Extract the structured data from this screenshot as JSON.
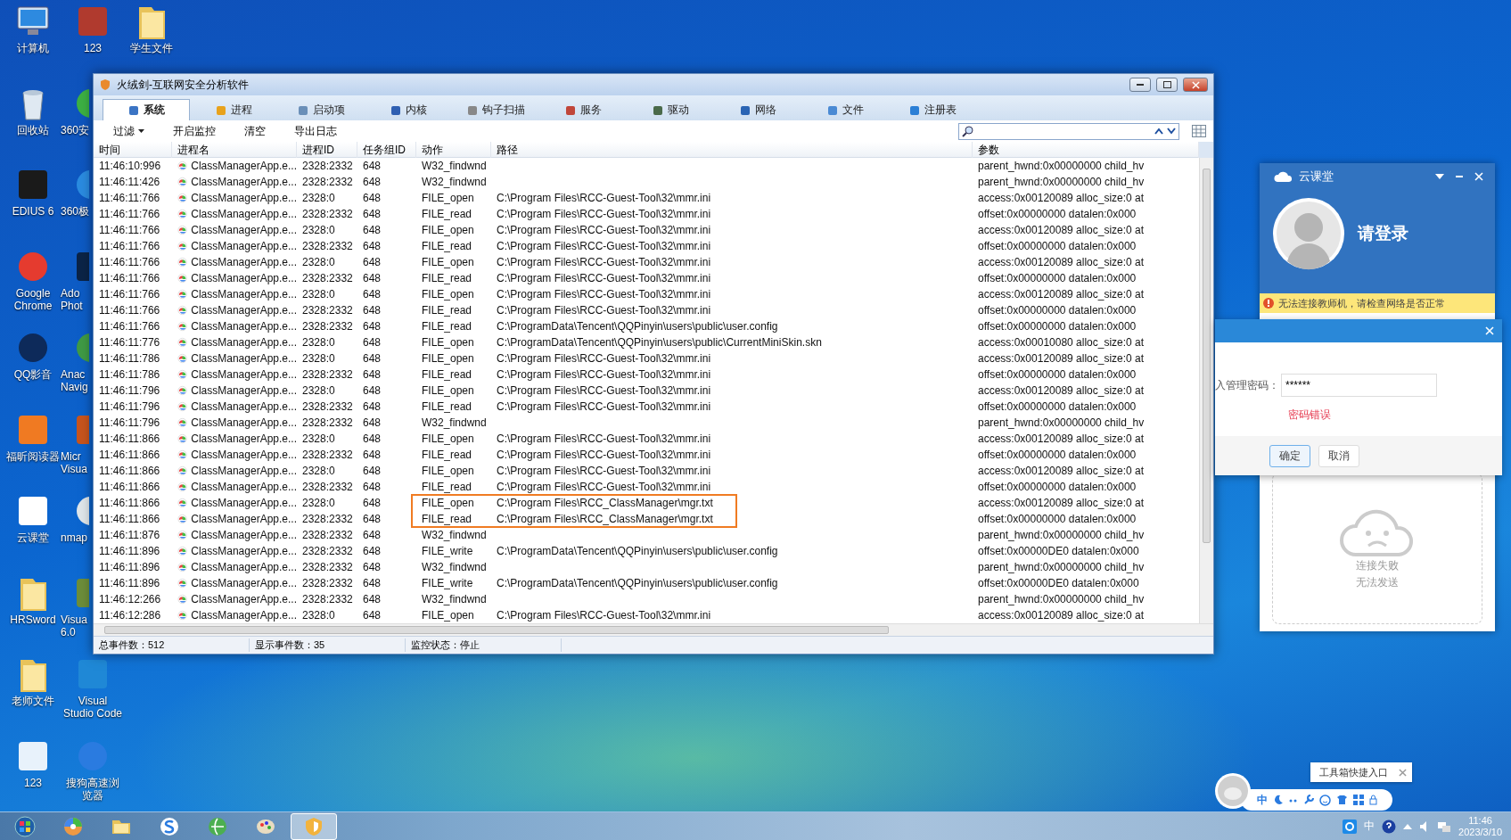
{
  "desktop": {
    "columns": [
      [
        {
          "label": "计算机",
          "kind": "computer"
        },
        {
          "label": "回收站",
          "kind": "bin"
        },
        {
          "label": "EDIUS 6",
          "kind": "tile",
          "color": "#1a1a1a"
        },
        {
          "label": "Google Chrome",
          "kind": "round",
          "color": "#e53b2f"
        },
        {
          "label": "QQ影音",
          "kind": "round",
          "color": "#0d2a5a"
        },
        {
          "label": "福昕阅读器",
          "kind": "tile",
          "color": "#f07a22"
        },
        {
          "label": "云课堂",
          "kind": "tile",
          "color": "#ffffff"
        },
        {
          "label": "HRSword",
          "kind": "folder"
        },
        {
          "label": "老师文件",
          "kind": "folder"
        },
        {
          "label": "123",
          "kind": "tile",
          "color": "#e8f2fb"
        }
      ],
      [
        {
          "label": "123",
          "kind": "tile",
          "color": "#b03a2e"
        },
        {
          "label": "360安",
          "kind": "round",
          "color": "#3cb043"
        },
        {
          "label": "360极",
          "kind": "round",
          "color": "#2a8be0"
        },
        {
          "label": "Ado Phot",
          "kind": "tile",
          "color": "#0b2447"
        },
        {
          "label": "Anac Navig",
          "kind": "round",
          "color": "#3f9a45"
        },
        {
          "label": "Micr Visua",
          "kind": "tile",
          "color": "#c7541d"
        },
        {
          "label": "nmap",
          "kind": "round",
          "color": "#dfe6ea"
        },
        {
          "label": "Visua 6.0",
          "kind": "tile",
          "color": "#6c8d3a"
        },
        {
          "label": "Visual Studio Code",
          "kind": "tile",
          "color": "#1f88d6"
        },
        {
          "label": "搜狗高速浏览器",
          "kind": "round",
          "color": "#2a7be0"
        }
      ],
      [
        {
          "label": "学生文件",
          "kind": "folder"
        }
      ]
    ]
  },
  "main_window": {
    "title": "火绒剑-互联网安全分析软件",
    "tabs": [
      {
        "label": "系统",
        "selected": true
      },
      {
        "label": "进程",
        "selected": false
      },
      {
        "label": "启动项",
        "selected": false
      },
      {
        "label": "内核",
        "selected": false
      },
      {
        "label": "钩子扫描",
        "selected": false
      },
      {
        "label": "服务",
        "selected": false
      },
      {
        "label": "驱动",
        "selected": false
      },
      {
        "label": "网络",
        "selected": false
      },
      {
        "label": "文件",
        "selected": false
      },
      {
        "label": "注册表",
        "selected": false
      }
    ],
    "toolbar": [
      "过滤",
      "开启监控",
      "清空",
      "导出日志"
    ],
    "columns": [
      "时间",
      "进程名",
      "进程ID",
      "任务组ID",
      "动作",
      "路径",
      "参数"
    ],
    "rows": [
      {
        "time": "11:46:10:996",
        "process": "ClassManagerApp.e...",
        "pid": "2328:2332",
        "task_group": "648",
        "action": "W32_findwnd",
        "path": "",
        "params": "parent_hwnd:0x00000000 child_hv",
        "highlighted": false
      },
      {
        "time": "11:46:11:426",
        "process": "ClassManagerApp.e...",
        "pid": "2328:2332",
        "task_group": "648",
        "action": "W32_findwnd",
        "path": "",
        "params": "parent_hwnd:0x00000000 child_hv",
        "highlighted": false
      },
      {
        "time": "11:46:11:766",
        "process": "ClassManagerApp.e...",
        "pid": "2328:0",
        "task_group": "648",
        "action": "FILE_open",
        "path": "C:\\Program Files\\RCC-Guest-Tool\\32\\mmr.ini",
        "params": "access:0x00120089 alloc_size:0 at",
        "highlighted": false
      },
      {
        "time": "11:46:11:766",
        "process": "ClassManagerApp.e...",
        "pid": "2328:2332",
        "task_group": "648",
        "action": "FILE_read",
        "path": "C:\\Program Files\\RCC-Guest-Tool\\32\\mmr.ini",
        "params": "offset:0x00000000 datalen:0x000",
        "highlighted": false
      },
      {
        "time": "11:46:11:766",
        "process": "ClassManagerApp.e...",
        "pid": "2328:0",
        "task_group": "648",
        "action": "FILE_open",
        "path": "C:\\Program Files\\RCC-Guest-Tool\\32\\mmr.ini",
        "params": "access:0x00120089 alloc_size:0 at",
        "highlighted": false
      },
      {
        "time": "11:46:11:766",
        "process": "ClassManagerApp.e...",
        "pid": "2328:2332",
        "task_group": "648",
        "action": "FILE_read",
        "path": "C:\\Program Files\\RCC-Guest-Tool\\32\\mmr.ini",
        "params": "offset:0x00000000 datalen:0x000",
        "highlighted": false
      },
      {
        "time": "11:46:11:766",
        "process": "ClassManagerApp.e...",
        "pid": "2328:0",
        "task_group": "648",
        "action": "FILE_open",
        "path": "C:\\Program Files\\RCC-Guest-Tool\\32\\mmr.ini",
        "params": "access:0x00120089 alloc_size:0 at",
        "highlighted": false
      },
      {
        "time": "11:46:11:766",
        "process": "ClassManagerApp.e...",
        "pid": "2328:2332",
        "task_group": "648",
        "action": "FILE_read",
        "path": "C:\\Program Files\\RCC-Guest-Tool\\32\\mmr.ini",
        "params": "offset:0x00000000 datalen:0x000",
        "highlighted": false
      },
      {
        "time": "11:46:11:766",
        "process": "ClassManagerApp.e...",
        "pid": "2328:0",
        "task_group": "648",
        "action": "FILE_open",
        "path": "C:\\Program Files\\RCC-Guest-Tool\\32\\mmr.ini",
        "params": "access:0x00120089 alloc_size:0 at",
        "highlighted": false
      },
      {
        "time": "11:46:11:766",
        "process": "ClassManagerApp.e...",
        "pid": "2328:2332",
        "task_group": "648",
        "action": "FILE_read",
        "path": "C:\\Program Files\\RCC-Guest-Tool\\32\\mmr.ini",
        "params": "offset:0x00000000 datalen:0x000",
        "highlighted": false
      },
      {
        "time": "11:46:11:766",
        "process": "ClassManagerApp.e...",
        "pid": "2328:2332",
        "task_group": "648",
        "action": "FILE_read",
        "path": "C:\\ProgramData\\Tencent\\QQPinyin\\users\\public\\user.config",
        "params": "offset:0x00000000 datalen:0x000",
        "highlighted": false
      },
      {
        "time": "11:46:11:776",
        "process": "ClassManagerApp.e...",
        "pid": "2328:0",
        "task_group": "648",
        "action": "FILE_open",
        "path": "C:\\ProgramData\\Tencent\\QQPinyin\\users\\public\\CurrentMiniSkin.skn",
        "params": "access:0x00010080 alloc_size:0 at",
        "highlighted": false
      },
      {
        "time": "11:46:11:786",
        "process": "ClassManagerApp.e...",
        "pid": "2328:0",
        "task_group": "648",
        "action": "FILE_open",
        "path": "C:\\Program Files\\RCC-Guest-Tool\\32\\mmr.ini",
        "params": "access:0x00120089 alloc_size:0 at",
        "highlighted": false
      },
      {
        "time": "11:46:11:786",
        "process": "ClassManagerApp.e...",
        "pid": "2328:2332",
        "task_group": "648",
        "action": "FILE_read",
        "path": "C:\\Program Files\\RCC-Guest-Tool\\32\\mmr.ini",
        "params": "offset:0x00000000 datalen:0x000",
        "highlighted": false
      },
      {
        "time": "11:46:11:796",
        "process": "ClassManagerApp.e...",
        "pid": "2328:0",
        "task_group": "648",
        "action": "FILE_open",
        "path": "C:\\Program Files\\RCC-Guest-Tool\\32\\mmr.ini",
        "params": "access:0x00120089 alloc_size:0 at",
        "highlighted": false
      },
      {
        "time": "11:46:11:796",
        "process": "ClassManagerApp.e...",
        "pid": "2328:2332",
        "task_group": "648",
        "action": "FILE_read",
        "path": "C:\\Program Files\\RCC-Guest-Tool\\32\\mmr.ini",
        "params": "offset:0x00000000 datalen:0x000",
        "highlighted": false
      },
      {
        "time": "11:46:11:796",
        "process": "ClassManagerApp.e...",
        "pid": "2328:2332",
        "task_group": "648",
        "action": "W32_findwnd",
        "path": "",
        "params": "parent_hwnd:0x00000000 child_hv",
        "highlighted": false
      },
      {
        "time": "11:46:11:866",
        "process": "ClassManagerApp.e...",
        "pid": "2328:0",
        "task_group": "648",
        "action": "FILE_open",
        "path": "C:\\Program Files\\RCC-Guest-Tool\\32\\mmr.ini",
        "params": "access:0x00120089 alloc_size:0 at",
        "highlighted": false
      },
      {
        "time": "11:46:11:866",
        "process": "ClassManagerApp.e...",
        "pid": "2328:2332",
        "task_group": "648",
        "action": "FILE_read",
        "path": "C:\\Program Files\\RCC-Guest-Tool\\32\\mmr.ini",
        "params": "offset:0x00000000 datalen:0x000",
        "highlighted": false
      },
      {
        "time": "11:46:11:866",
        "process": "ClassManagerApp.e...",
        "pid": "2328:0",
        "task_group": "648",
        "action": "FILE_open",
        "path": "C:\\Program Files\\RCC-Guest-Tool\\32\\mmr.ini",
        "params": "access:0x00120089 alloc_size:0 at",
        "highlighted": false
      },
      {
        "time": "11:46:11:866",
        "process": "ClassManagerApp.e...",
        "pid": "2328:2332",
        "task_group": "648",
        "action": "FILE_read",
        "path": "C:\\Program Files\\RCC-Guest-Tool\\32\\mmr.ini",
        "params": "offset:0x00000000 datalen:0x000",
        "highlighted": false
      },
      {
        "time": "11:46:11:866",
        "process": "ClassManagerApp.e...",
        "pid": "2328:0",
        "task_group": "648",
        "action": "FILE_open",
        "path": "C:\\Program Files\\RCC_ClassManager\\mgr.txt",
        "params": "access:0x00120089 alloc_size:0 at",
        "highlighted": true
      },
      {
        "time": "11:46:11:866",
        "process": "ClassManagerApp.e...",
        "pid": "2328:2332",
        "task_group": "648",
        "action": "FILE_read",
        "path": "C:\\Program Files\\RCC_ClassManager\\mgr.txt",
        "params": "offset:0x00000000 datalen:0x000",
        "highlighted": true
      },
      {
        "time": "11:46:11:876",
        "process": "ClassManagerApp.e...",
        "pid": "2328:2332",
        "task_group": "648",
        "action": "W32_findwnd",
        "path": "",
        "params": "parent_hwnd:0x00000000 child_hv",
        "highlighted": false
      },
      {
        "time": "11:46:11:896",
        "process": "ClassManagerApp.e...",
        "pid": "2328:2332",
        "task_group": "648",
        "action": "FILE_write",
        "path": "C:\\ProgramData\\Tencent\\QQPinyin\\users\\public\\user.config",
        "params": "offset:0x00000DE0 datalen:0x000",
        "highlighted": false
      },
      {
        "time": "11:46:11:896",
        "process": "ClassManagerApp.e...",
        "pid": "2328:2332",
        "task_group": "648",
        "action": "W32_findwnd",
        "path": "",
        "params": "parent_hwnd:0x00000000 child_hv",
        "highlighted": false
      },
      {
        "time": "11:46:11:896",
        "process": "ClassManagerApp.e...",
        "pid": "2328:2332",
        "task_group": "648",
        "action": "FILE_write",
        "path": "C:\\ProgramData\\Tencent\\QQPinyin\\users\\public\\user.config",
        "params": "offset:0x00000DE0 datalen:0x000",
        "highlighted": false
      },
      {
        "time": "11:46:12:266",
        "process": "ClassManagerApp.e...",
        "pid": "2328:2332",
        "task_group": "648",
        "action": "W32_findwnd",
        "path": "",
        "params": "parent_hwnd:0x00000000 child_hv",
        "highlighted": false
      },
      {
        "time": "11:46:12:286",
        "process": "ClassManagerApp.e...",
        "pid": "2328:0",
        "task_group": "648",
        "action": "FILE_open",
        "path": "C:\\Program Files\\RCC-Guest-Tool\\32\\mmr.ini",
        "params": "access:0x00120089 alloc_size:0 at",
        "highlighted": false
      }
    ],
    "status_bar": [
      "总事件数：512",
      "显示事件数：35",
      "监控状态：停止"
    ]
  },
  "cloud_panel": {
    "title": "云课堂",
    "login_prompt": "请登录",
    "warning": "无法连接教师机，请检查网络是否正常",
    "empty_lines": [
      "连接失败",
      "无法发送"
    ]
  },
  "password_dialog": {
    "label": "入管理密码：",
    "value": "******",
    "error": "密码错误",
    "buttons": [
      {
        "label": "确定",
        "selected": true
      },
      {
        "label": "取消",
        "selected": false
      }
    ]
  },
  "qq_bar": {
    "tooltip": "工具箱快捷入口",
    "ime_label": "中"
  },
  "taskbar": {
    "pinned": [
      {
        "kind": "start",
        "selected": false
      },
      {
        "kind": "wheel",
        "selected": false
      },
      {
        "kind": "folder",
        "selected": false
      },
      {
        "kind": "sogou",
        "selected": false
      },
      {
        "kind": "globe",
        "selected": false
      },
      {
        "kind": "palette",
        "selected": false
      },
      {
        "kind": "shield",
        "selected": true
      }
    ],
    "tray_ime": "中",
    "time": "11:46",
    "date": "2023/3/10"
  }
}
